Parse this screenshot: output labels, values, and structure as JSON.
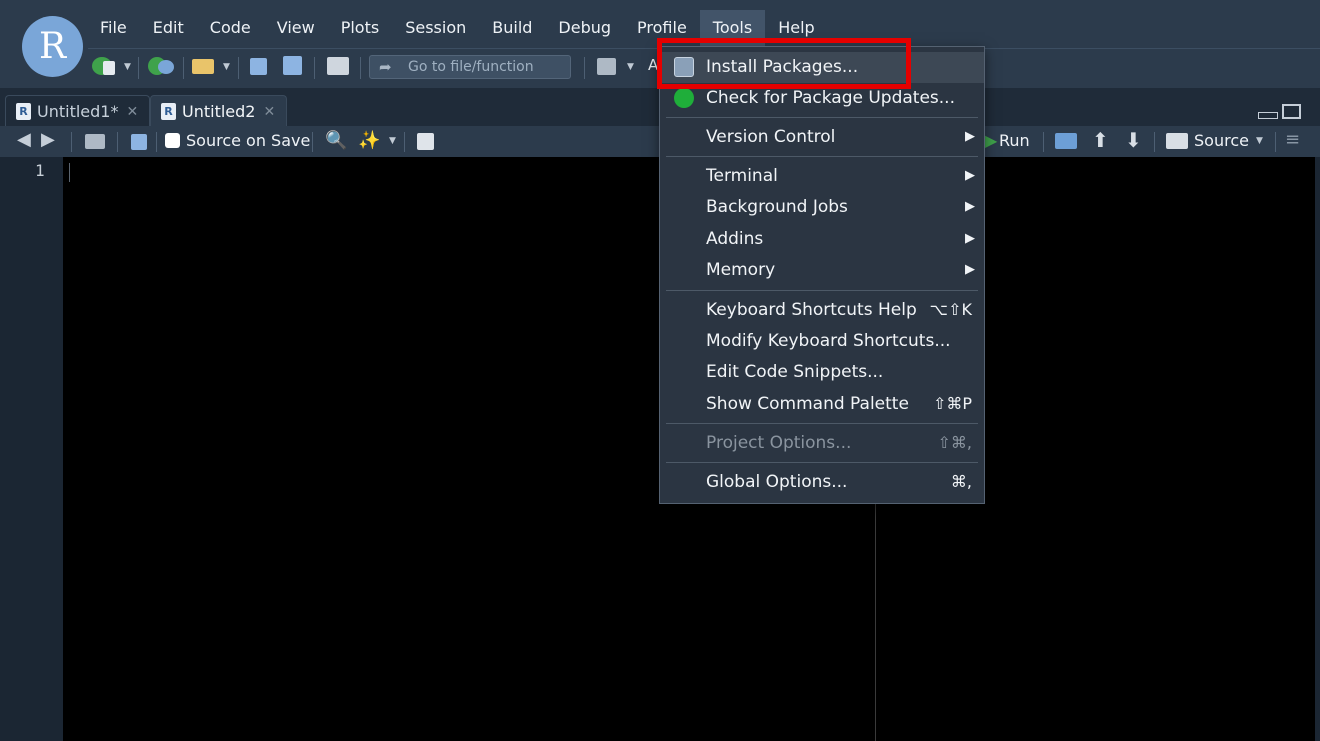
{
  "app": {
    "logo_letter": "R"
  },
  "menubar": {
    "items": [
      "File",
      "Edit",
      "Code",
      "View",
      "Plots",
      "Session",
      "Build",
      "Debug",
      "Profile",
      "Tools",
      "Help"
    ],
    "active": "Tools"
  },
  "main_toolbar": {
    "goto_placeholder": "Go to file/function",
    "addins_label": "A"
  },
  "tabs": [
    {
      "label": "Untitled1*",
      "active": false
    },
    {
      "label": "Untitled2",
      "active": true
    }
  ],
  "editor_toolbar": {
    "source_on_save": "Source on Save",
    "run": "Run",
    "source": "Source"
  },
  "editor": {
    "line_numbers": [
      "1"
    ]
  },
  "tools_menu": {
    "install_packages": "Install Packages...",
    "check_updates": "Check for Package Updates...",
    "version_control": "Version Control",
    "terminal": "Terminal",
    "background_jobs": "Background Jobs",
    "addins": "Addins",
    "memory": "Memory",
    "kb_help": "Keyboard Shortcuts Help",
    "kb_help_short": "⌥⇧K",
    "modify_kb": "Modify Keyboard Shortcuts...",
    "edit_snippets": "Edit Code Snippets...",
    "command_palette": "Show Command Palette",
    "command_palette_short": "⇧⌘P",
    "project_options": "Project Options...",
    "project_options_short": "⇧⌘,",
    "global_options": "Global Options...",
    "global_options_short": "⌘,"
  },
  "colors": {
    "highlight_box": "#e50000",
    "menu_bg": "#2b3542",
    "toolbar_bg": "#2c3b4c",
    "editor_bg": "#000000"
  }
}
